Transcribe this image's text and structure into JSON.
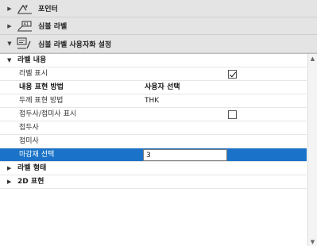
{
  "sections": [
    {
      "label": "포인터",
      "arrow": "▶",
      "icon": "pointer-icon"
    },
    {
      "label": "심볼 라벨",
      "arrow": "▶",
      "icon": "symbol-label-icon"
    },
    {
      "label": "심볼 라벨 사용자화 설정",
      "arrow": "▼",
      "icon": "custom-settings-icon"
    }
  ],
  "group_label": {
    "label": "라벨 내용",
    "arrow": "▼"
  },
  "rows": [
    {
      "name": "라벨 표시",
      "checked": true
    },
    {
      "name": "내용 표현 방법",
      "value": "사용자 선택"
    },
    {
      "name": "두께 표현 방법",
      "value": "THK"
    },
    {
      "name": "접두사/접미사 표시",
      "checked": false
    },
    {
      "name": "접두사"
    },
    {
      "name": "접미사"
    },
    {
      "name": "마감재 선택",
      "input_value": "3"
    }
  ],
  "subgroups": [
    {
      "label": "라벨 형태",
      "arrow": "▶"
    },
    {
      "label": "2D 표현",
      "arrow": "▶"
    }
  ],
  "scrollbar": {
    "up": "▲",
    "down": "▼"
  },
  "colors": {
    "selection": "#1a73c8",
    "header": "#e4e4e4"
  }
}
